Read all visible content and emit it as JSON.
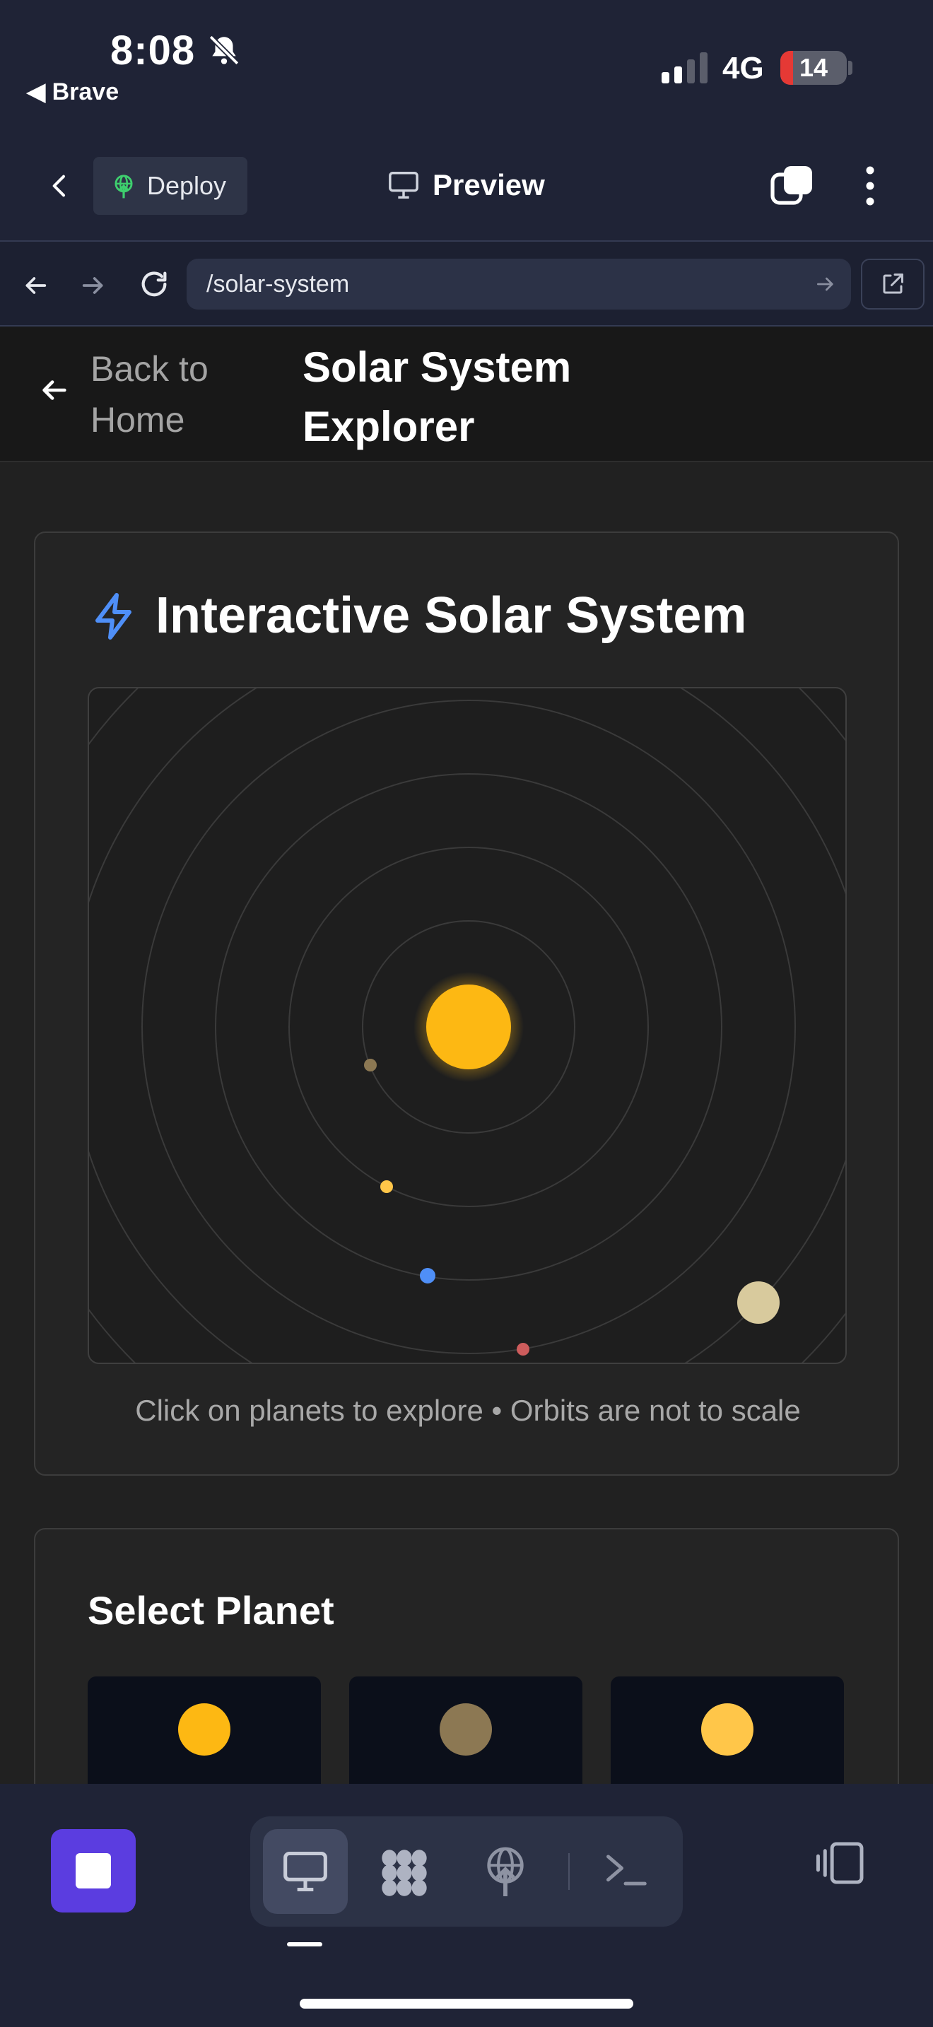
{
  "status_bar": {
    "time": "8:08",
    "back_app": "◀ Brave",
    "network": "4G",
    "battery": "14"
  },
  "app_header": {
    "deploy_label": "Deploy",
    "preview_label": "Preview"
  },
  "browser": {
    "url": "/solar-system"
  },
  "page": {
    "back_label": "Back to Home",
    "title": "Solar System Explorer",
    "solar_card": {
      "title": "Interactive Solar System",
      "caption": "Click on planets to explore • Orbits are not to scale",
      "colors": {
        "sun": "#fdb813",
        "mercury": "#8c7853",
        "venus": "#ffc649",
        "earth": "#4f8ff7",
        "mars": "#cd5c5c",
        "jupiter": "#d8ca9d"
      }
    },
    "select_card": {
      "title": "Select Planet",
      "tiles": [
        {
          "color": "#fdb813"
        },
        {
          "color": "#8c7853"
        },
        {
          "color": "#ffc649"
        }
      ]
    }
  },
  "bottom_bar": {
    "tabs": [
      "desktop-icon",
      "grid-icon",
      "deploy-icon",
      "terminal-icon"
    ],
    "active_tab": "desktop-icon"
  }
}
